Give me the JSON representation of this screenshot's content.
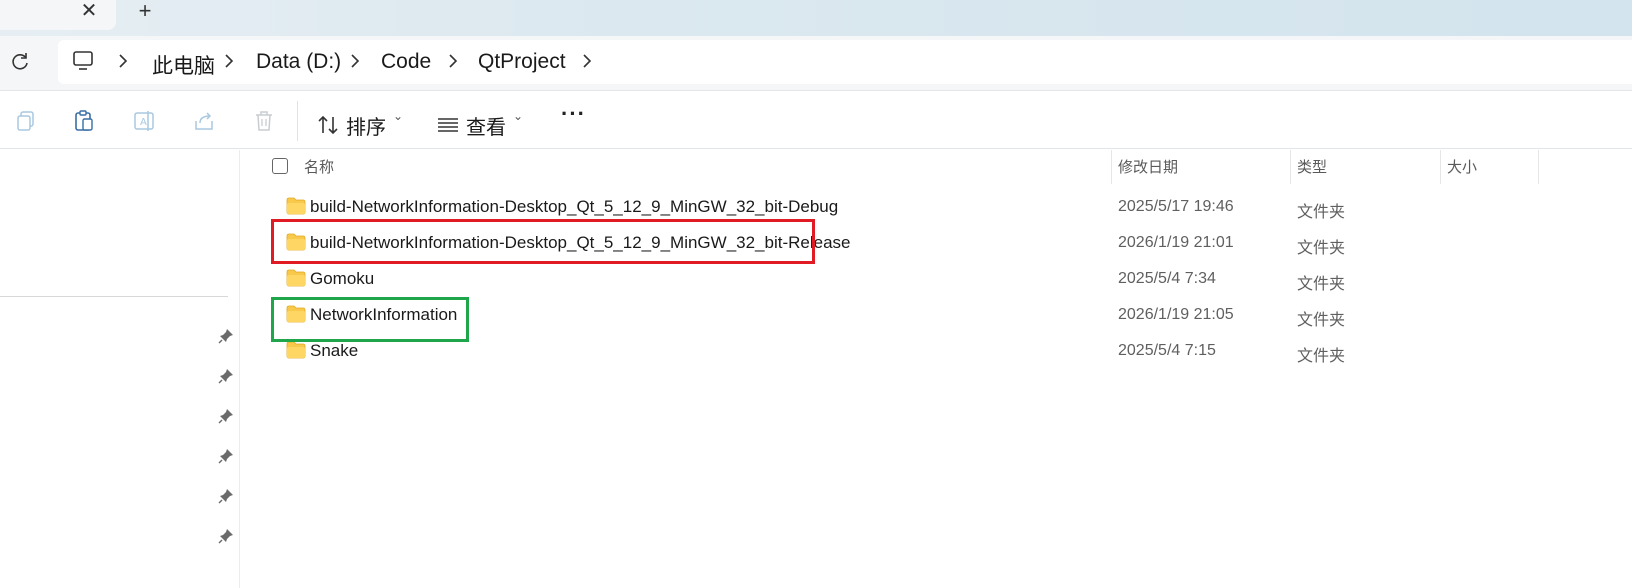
{
  "tabs": {
    "close_glyph": "✕",
    "new_glyph": "+"
  },
  "breadcrumb": [
    {
      "label": "此电脑"
    },
    {
      "label": "Data (D:)"
    },
    {
      "label": "Code"
    },
    {
      "label": "QtProject"
    }
  ],
  "toolbar": {
    "sort_label": "排序",
    "view_label": "查看",
    "more_label": "···",
    "icons": [
      "copy-icon",
      "paste-icon",
      "rename-icon",
      "share-icon",
      "delete-icon",
      "sort-icon",
      "view-icon",
      "more-icon"
    ]
  },
  "columns": {
    "name": "名称",
    "date": "修改日期",
    "type": "类型",
    "size": "大小"
  },
  "files": [
    {
      "name": "build-NetworkInformation-Desktop_Qt_5_12_9_MinGW_32_bit-Debug",
      "date": "2025/5/17 19:46",
      "type": "文件夹"
    },
    {
      "name": "build-NetworkInformation-Desktop_Qt_5_12_9_MinGW_32_bit-Release",
      "date": "2026/1/19 21:01",
      "type": "文件夹"
    },
    {
      "name": "Gomoku",
      "date": "2025/5/4 7:34",
      "type": "文件夹"
    },
    {
      "name": "NetworkInformation",
      "date": "2026/1/19 21:05",
      "type": "文件夹"
    },
    {
      "name": "Snake",
      "date": "2025/5/4 7:15",
      "type": "文件夹"
    }
  ],
  "highlights": {
    "red_color": "#e01b24",
    "green_color": "#1fa64a"
  },
  "colors": {
    "folder": "#f8c94a",
    "address_bg": "#f4f6f7"
  }
}
